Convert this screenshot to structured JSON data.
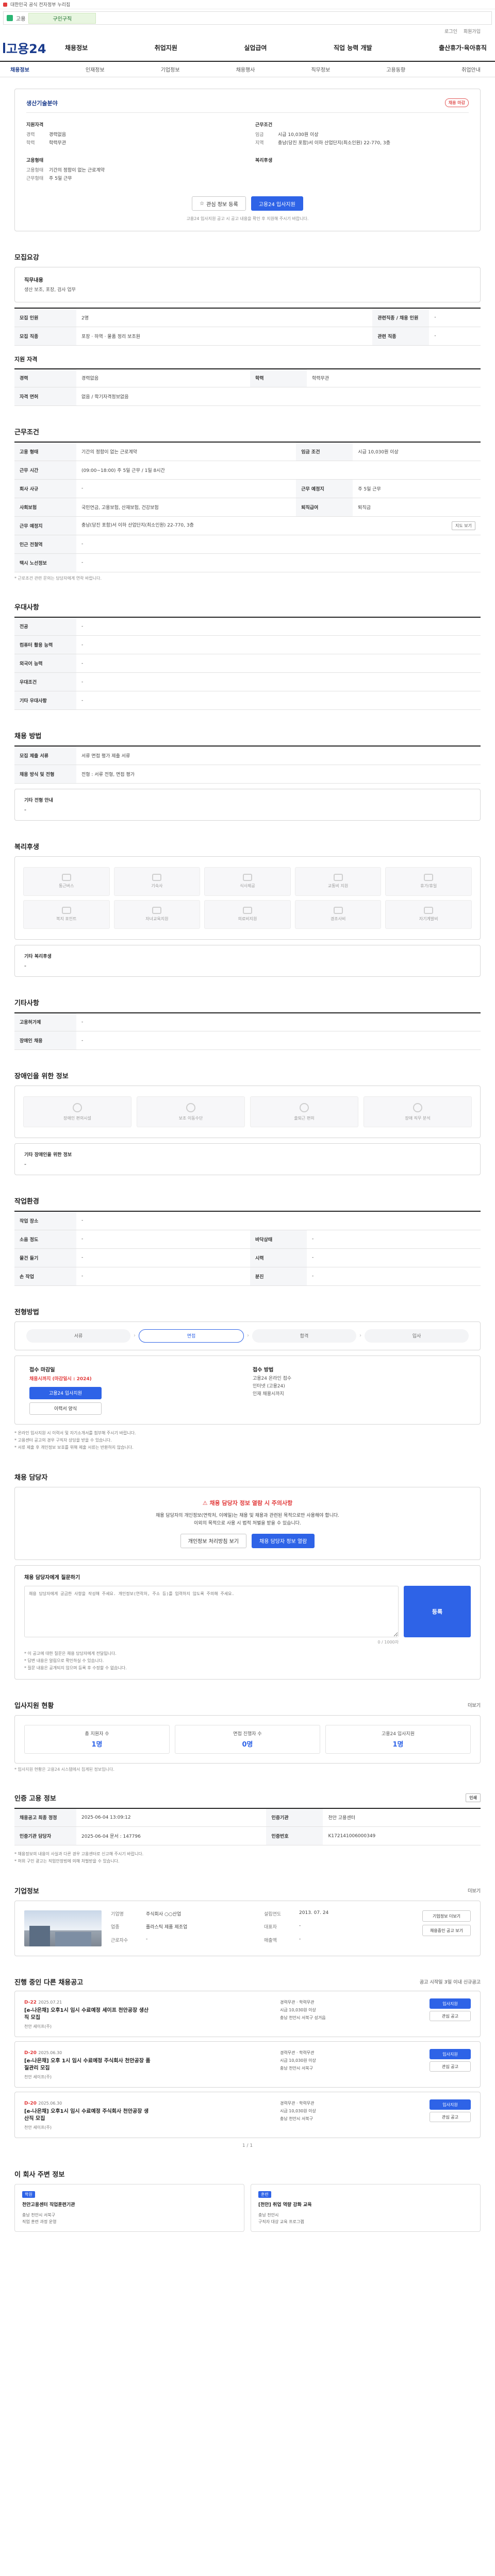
{
  "topbar": {
    "text": "대한민국 공식 전자정부 누리집"
  },
  "greenbar": {
    "label": "고용",
    "highlight": "구인구직"
  },
  "quick": [
    "로그인",
    "회원가입"
  ],
  "logo": {
    "name": "고용24"
  },
  "gnb": [
    "채용정보",
    "취업지원",
    "실업급여",
    "직업 능력 개발",
    "출산휴가·육아휴직"
  ],
  "subnav": [
    "채용정보",
    "인재정보",
    "기업정보",
    "채용행사",
    "직무정보",
    "고용동향",
    "취업안내"
  ],
  "card": {
    "company": "생산기술분야",
    "badge": "채용 마감",
    "left_title": "지원자격",
    "left": [
      {
        "k": "경력",
        "v": "경력없음"
      },
      {
        "k": "학력",
        "v": "학력무관"
      }
    ],
    "right_title": "근무조건",
    "right": [
      {
        "k": "임금",
        "v": "시급 10,030원 이상"
      },
      {
        "k": "지역",
        "v": "충남(당진 포함)서 이하 산업단지(최소인원) 22-770, 3층"
      }
    ],
    "left2_title": "고용형태",
    "left2": [
      {
        "k": "고용형태",
        "v": "기간의 정함이 없는 근로계약"
      },
      {
        "k": "근무형태",
        "v": "주 5일 근무"
      }
    ],
    "right2_title": "복리후생",
    "right2": [
      {
        "k": "",
        "v": ""
      }
    ],
    "btn_scrap": "관심 정보 등록",
    "btn_apply": "고용24 입사지원",
    "note": "고용24 입사지원 공고 시 공고 내용을 확인 후 지원해 주시기 바랍니다."
  },
  "recruit": {
    "title": "모집요강",
    "job_title": "직무내용",
    "job_text": "생산 보조, 포장, 검사 업무",
    "rows": [
      {
        "k1": "모집 인원",
        "v1": "2명",
        "k2": "관련직종 / 채용 인원",
        "v2": "-"
      },
      {
        "k1": "모집 직종",
        "v1": "포장 · 하역 · 물품 정리 보조원",
        "k2": "관련 직종",
        "v2": "-"
      }
    ],
    "sub_title": "지원 자격",
    "rows2": [
      {
        "k1": "경력",
        "v1": "경력없음",
        "k2": "학력",
        "v2": "학력무관"
      },
      {
        "k1": "자격 면허",
        "v1": "없음 / 학기자격정보없음",
        "k2": "",
        "v2": ""
      }
    ]
  },
  "work": {
    "title": "근무조건",
    "rows": [
      {
        "k1": "고용 형태",
        "v1": "기간의 정함이 없는 근로계약",
        "k2": "임금 조건",
        "v2": "시급 10,030원 이상"
      },
      {
        "k1": "근무 시간",
        "v1": "(09:00~18:00) 주 5일 근무 / 1일 8시간",
        "k2": "",
        "v2": ""
      },
      {
        "k1": "회사 사규",
        "v1": "-",
        "k2": "근무 예정지",
        "v2": "주 5일 근무"
      },
      {
        "k1": "사회보험",
        "v1": "국민연금, 고용보험, 산재보험, 건강보험",
        "k2": "퇴직급여",
        "v2": "퇴직금"
      },
      {
        "k1": "근무 예정지",
        "v1": "충남(당진 포함)서 이하 산업단지(최소인원) 22-770, 3층",
        "k2": "",
        "v2": ""
      },
      {
        "k1": "인근 전철역",
        "v1": "-",
        "k2": "",
        "v2": ""
      },
      {
        "k1": "택시 노선정보",
        "v1": "-",
        "k2": "",
        "v2": ""
      }
    ],
    "map_btn": "지도 보기",
    "note": "* 근로조건 관련 문의는 담당자에게 연락 바랍니다."
  },
  "extra": {
    "title": "우대사항",
    "rows": [
      {
        "k": "전공",
        "v": "-"
      },
      {
        "k": "컴퓨터 활용 능력",
        "v": "-"
      },
      {
        "k": "외국어 능력",
        "v": "-"
      },
      {
        "k": "우대조건",
        "v": "-"
      },
      {
        "k": "기타 우대사항",
        "v": "-"
      }
    ]
  },
  "selection": {
    "title": "채용 방법",
    "rows": [
      {
        "k": "모집 제출 서류",
        "v": "서류 면접 평가 제출 서류"
      },
      {
        "k": "채용 방식 및 전형",
        "v": "전형 : 서류 전형, 면접 평가"
      }
    ],
    "sub_title": "기타 전형 안내",
    "sub_text": "-"
  },
  "welfare": {
    "title": "복리후생",
    "items": [
      "통근버스",
      "기숙사",
      "식사제공",
      "교통비 지원",
      "휴가/휴일",
      "복지 포인트",
      "자녀교육지원",
      "의료비지원",
      "경조사비",
      "자기계발비"
    ],
    "sub_title": "기타 복리후생",
    "sub_text": "-"
  },
  "etc": {
    "title": "기타사항",
    "rows": [
      {
        "k": "고용허가제",
        "v": "-"
      },
      {
        "k": "장애인 채용",
        "v": "-"
      }
    ]
  },
  "disability": {
    "title": "장애인을 위한 정보",
    "items": [
      "장애인 편의시설",
      "보조 이동수단",
      "출퇴근 편의",
      "장애 직무 분석"
    ],
    "sub_title": "기타 장애인을 위한 정보",
    "sub_text": "-"
  },
  "env": {
    "title": "작업환경",
    "rows": [
      {
        "k1": "작업 장소",
        "v1": "-",
        "k2": "",
        "v2": ""
      },
      {
        "k1": "소음 정도",
        "v1": "-",
        "k2": "바닥상태",
        "v2": "-"
      },
      {
        "k1": "물건 들기",
        "v1": "-",
        "k2": "시력",
        "v2": "-"
      },
      {
        "k1": "손 작업",
        "v1": "-",
        "k2": "분진",
        "v2": "-"
      }
    ]
  },
  "process": {
    "title": "전형방법",
    "steps": [
      "서류",
      "면접",
      "합격",
      "입사"
    ],
    "on": 1
  },
  "apply": {
    "t1": "접수 마감일",
    "d1": "채용시까지 (마감일시 : 2024)",
    "t2": "접수 방법",
    "v2": "고용24 온라인 접수",
    "btn1": "고용24 입사지원",
    "btn2": "이력서 양식",
    "v3": "인터넷 (고용24)",
    "v4": "인재 채용시까지",
    "bullets": [
      "* 온라인 입사지원 시 이력서 및 자기소개서를 첨부해 주시기 바랍니다.",
      "* 고용센터 공고의 경우 구직자 상담을 받을 수 있습니다.",
      "* 서류 제출 후 개인정보 보호를 위해 제출 서류는 반환하지 않습니다."
    ]
  },
  "contact": {
    "title": "채용 담당자",
    "alert": "채용 담당자 정보 열람 시 주의사항",
    "text1": "채용 담당자의 개인정보(연락처, 이메일)는 채용 및 채용과 관련된 목적으로만 사용해야 합니다.",
    "text2": "이외의 목적으로 사용 시 법적 처벌을 받을 수 있습니다.",
    "btn1": "채용 담당자 정보 열람",
    "btn2": "개인정보 처리방침 보기"
  },
  "question": {
    "title": "채용 담당자에게 질문하기",
    "placeholder": "채용 담당자에게 궁금한 사항을 작성해 주세요. 개인정보(연락처, 주소 등)를 입력하지 않도록 주의해 주세요.",
    "send": "등록",
    "count": "0 / 1000자",
    "notes": [
      "* 이 공고에 대한 질문은 채용 담당자에게 전달됩니다.",
      "* 답변 내용은 알림으로 확인하실 수 있습니다.",
      "* 질문 내용은 공개되지 않으며 등록 후 수정할 수 없습니다."
    ]
  },
  "stats": {
    "title": "입사지원 현황",
    "more": "더보기",
    "items": [
      {
        "label": "총 지원자 수",
        "n": "1명"
      },
      {
        "label": "면접 진행자 수",
        "n": "0명"
      },
      {
        "label": "고용24 입사지원",
        "n": "1명"
      }
    ],
    "note": "* 입사지원 현황은 고용24 시스템에서 집계된 정보입니다."
  },
  "reg": {
    "title": "인증 고용 정보",
    "print": "인쇄",
    "rows": [
      {
        "k1": "채용공고 최종 정정",
        "v1": "2025-06-04 13:09:12",
        "k2": "인증기관",
        "v2": "천안 고용센터"
      },
      {
        "k1": "인증기관 담당자",
        "v1": "2025-06-04 문서 : 147796",
        "k2": "인증번호",
        "v2": "K172141006000349"
      }
    ],
    "notes": [
      "* 채용정보의 내용이 사실과 다른 경우 고용센터로 신고해 주시기 바랍니다.",
      "* 허위 구인 광고는 직업안정법에 의해 처벌받을 수 있습니다."
    ]
  },
  "company": {
    "title": "기업정보",
    "more": "더보기",
    "rows": [
      {
        "k1": "기업명",
        "v1": "주식회사 ○○산업",
        "k2": "설립연도",
        "v2": "2013. 07. 24"
      },
      {
        "k1": "업종",
        "v1": "플라스틱 제품 제조업",
        "k2": "대표자",
        "v2": "-"
      },
      {
        "k1": "근로자수",
        "v1": "-",
        "k2": "매출액",
        "v2": "-"
      }
    ],
    "btn1": "기업정보 더보기",
    "btn2": "채용중인 공고 보기"
  },
  "related": {
    "title": "진행 중인 다른 채용공고",
    "note": "공고 시작일 3일 이내 신규공고",
    "items": [
      {
        "dday": "D-22",
        "date": "2025.07.21",
        "title": "[e-나은채] 오후1시 임시 수료예정 세이프 천안공장 생산직 모집",
        "sub": "천안 세이프(주)",
        "mid1": "경력무관 · 학력무관",
        "mid2": "시급 10,030원 이상",
        "mid3": "충남 천안시 서북구 성거읍",
        "btn1": "입사지원",
        "btn2": "관심 공고"
      },
      {
        "dday": "D-20",
        "date": "2025.06.30",
        "title": "[e-나은채] 오후 1시 임시 수료예정 주식회사 천안공장 품질관리 모집",
        "sub": "천안 세이프(주)",
        "mid1": "경력무관 · 학력무관",
        "mid2": "시급 10,030원 이상",
        "mid3": "충남 천안시 서북구",
        "btn1": "입사지원",
        "btn2": "관심 공고"
      },
      {
        "dday": "D-20",
        "date": "2025.06.30",
        "title": "[e-나은채] 오후1시 임시 수료예정 주식회사 천안공장 생산직 모집",
        "sub": "천안 세이프(주)",
        "mid1": "경력무관 · 학력무관",
        "mid2": "시급 10,030원 이상",
        "mid3": "충남 천안시 서북구",
        "btn1": "입사지원",
        "btn2": "관심 공고"
      }
    ],
    "pager": "1 / 1"
  },
  "near": {
    "title": "이 회사 주변 정보",
    "items": [
      {
        "tag": "학원",
        "name": "천안고용센터 직업훈련기관",
        "l1": "충남 천안시 서북구",
        "l2": "직업 훈련 과정 운영"
      },
      {
        "tag": "훈련",
        "name": "[천안] 취업 역량 강화 교육",
        "l1": "충남 천안시",
        "l2": "구직자 대상 교육 프로그램"
      }
    ]
  }
}
